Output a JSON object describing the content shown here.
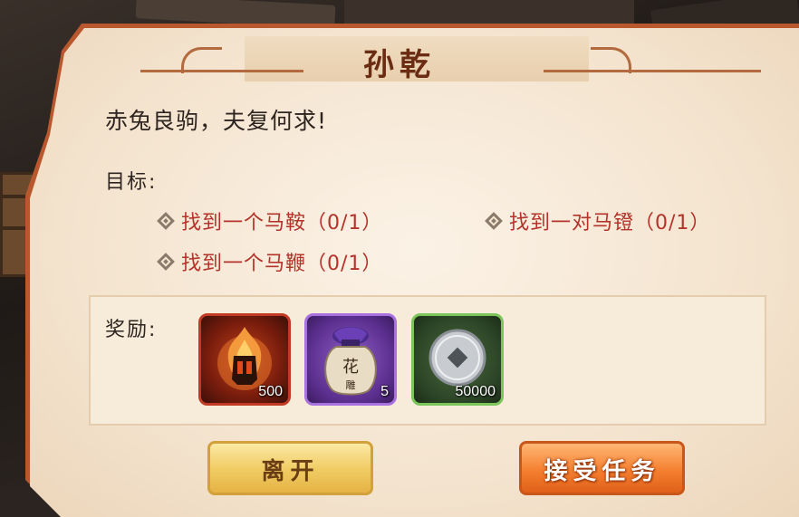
{
  "dialog": {
    "title": "孙乾",
    "subtitle": "赤兔良驹，夫复何求!",
    "goals_label": "目标:",
    "goals": [
      {
        "text": "找到一个马鞍（0/1）"
      },
      {
        "text": "找到一对马镫（0/1）"
      },
      {
        "text": "找到一个马鞭（0/1）"
      }
    ],
    "rewards_label": "奖励:",
    "rewards": [
      {
        "icon": "flame-helmet-icon",
        "count": "500",
        "frame_color": "#c23a24"
      },
      {
        "icon": "wine-jar-icon",
        "jar_text": "花",
        "jar_text2": "雕",
        "count": "5",
        "frame_color": "#a772df"
      },
      {
        "icon": "coin-icon",
        "count": "50000",
        "frame_color": "#7cc55a"
      }
    ],
    "buttons": {
      "leave_label": "离开",
      "accept_label": "接受任务"
    }
  }
}
